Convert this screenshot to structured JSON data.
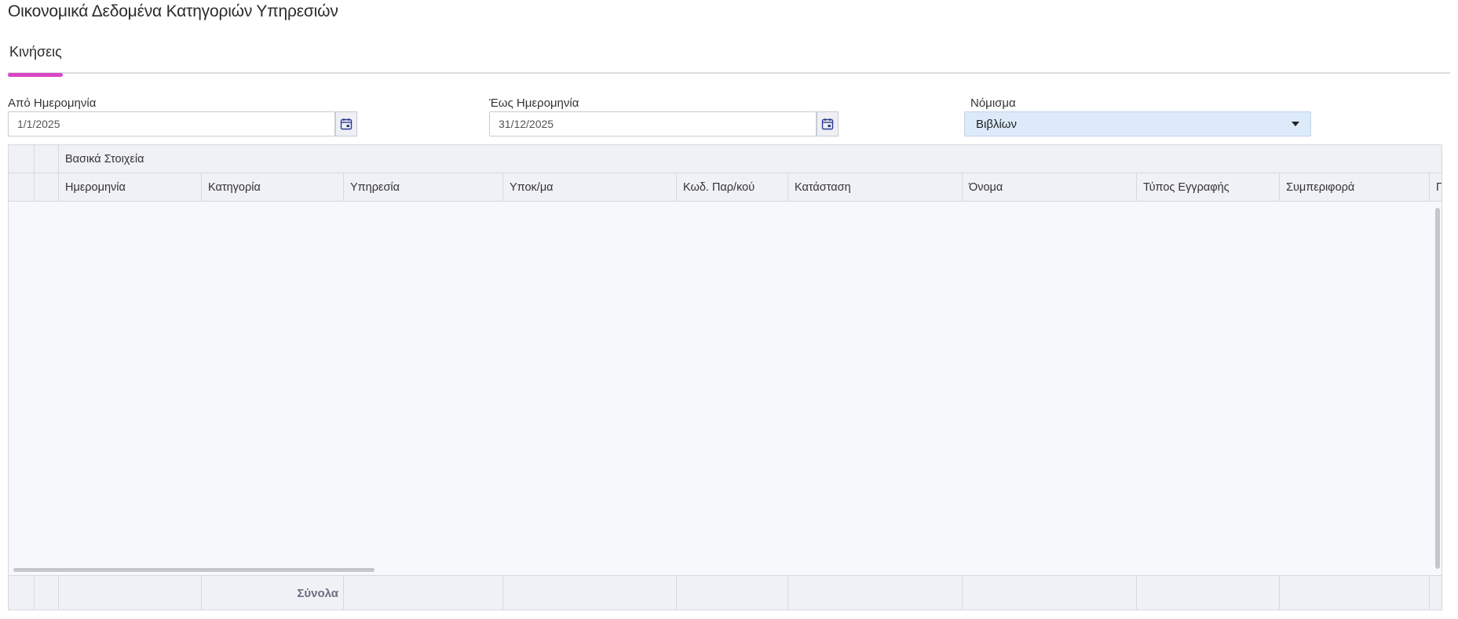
{
  "page": {
    "title": "Οικονομικά Δεδομένα Κατηγοριών Υπηρεσιών"
  },
  "tabs": [
    {
      "label": "Κινήσεις",
      "active": true
    }
  ],
  "filters": {
    "from_date": {
      "label": "Από Ημερομηνία",
      "value": "1/1/2025"
    },
    "to_date": {
      "label": "Έως Ημερομηνία",
      "value": "31/12/2025"
    },
    "currency": {
      "label": "Νόμισμα",
      "value": "Βιβλίων"
    }
  },
  "grid": {
    "group_header": "Βασικά Στοιχεία",
    "columns": [
      "Ημερομηνία",
      "Κατηγορία",
      "Υπηρεσία",
      "Υποκ/μα",
      "Κωδ. Παρ/κού",
      "Κατάσταση",
      "Όνομα",
      "Τύπος Εγγραφής",
      "Συμπεριφορά",
      "Γ"
    ],
    "totals_label": "Σύνολα"
  },
  "colors": {
    "accent_underline": "#d946c5",
    "select_bg": "#dceaf9",
    "header_bg": "#f0f1f7"
  },
  "icons": {
    "date_picker": "calendar-icon",
    "dropdown": "caret-down-icon"
  }
}
